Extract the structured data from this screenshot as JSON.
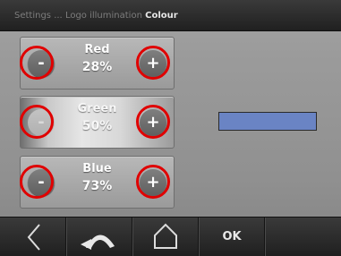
{
  "header": {
    "breadcrumb": [
      "Settings",
      "Logo illumination",
      "Colour"
    ],
    "separator": "..."
  },
  "controls": [
    {
      "name": "Red",
      "percent": "28%",
      "minus_label": "-",
      "plus_label": "+",
      "minus_enabled": true
    },
    {
      "name": "Green",
      "percent": "50%",
      "minus_label": "-",
      "plus_label": "+",
      "minus_enabled": false
    },
    {
      "name": "Blue",
      "percent": "73%",
      "minus_label": "-",
      "plus_label": "+",
      "minus_enabled": true
    }
  ],
  "preview": {
    "color": "#6a84c4"
  },
  "bottom_nav": {
    "back_icon": "back-arrow-icon",
    "undo_icon": "undo-arch-icon",
    "home_icon": "home-icon",
    "ok_label": "OK"
  },
  "colors": {
    "highlight_ring": "#e00000",
    "header_current": "#e6e6e6"
  }
}
